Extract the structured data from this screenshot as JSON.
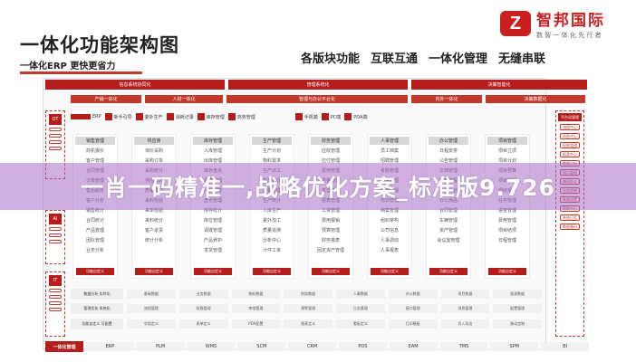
{
  "header": {
    "title": "一体化功能架构图",
    "subtitle": "一体化ERP 更快更省力",
    "features": [
      "各版块功能",
      "互联互通",
      "一体化管理",
      "无缝串联"
    ]
  },
  "logo": {
    "mark": "Z",
    "name": "智邦国际",
    "slogan": "数 智 一 体 化 先 行 者"
  },
  "top_bars": [
    "信息系统协同化",
    "管理系统化",
    "决策智能化"
  ],
  "sub_bars": [
    "产销一体化",
    "人财一体化",
    "管理与办公平台化",
    "内外一体化",
    "决策数据化"
  ],
  "left_tags": [
    "OT",
    "AI",
    "IT"
  ],
  "tools": [
    "ERP",
    "新手引导",
    "委外生产",
    "消耗记录",
    "库存管理",
    "商务管理",
    "手机端",
    "PC端",
    "PDA端"
  ],
  "modules": [
    {
      "head": "销售管理",
      "items": [
        "商机报价",
        "客户管理",
        "合同管理",
        "订单管理",
        "售后服务",
        "客户分析",
        "销售统计",
        "合同统计",
        "产品管理",
        "团队管理",
        "业务分析"
      ]
    },
    {
      "head": "供应商",
      "items": [
        "询价采购",
        "采购订单",
        "采购统计",
        "供应管理",
        "质量检验",
        "来料检验",
        "来单检验",
        "来料统计",
        "客户退货",
        "统计分析"
      ]
    },
    {
      "head": "库存管理",
      "items": [
        "入库管理",
        "出库管理",
        "库存盘点",
        "调拨管理",
        "库存预警",
        "盘点管理",
        "库存统计",
        "库位管理",
        "调拨管理",
        "产品养护",
        "发货管理"
      ]
    },
    {
      "head": "生产管理",
      "items": [
        "生产计划",
        "物料需求",
        "生产派工",
        "生产执行",
        "质量管理",
        "生产统计",
        "入库生产",
        "委外加工",
        "质量追溯",
        "分析中心",
        "计件工资"
      ]
    },
    {
      "head": "财务管理",
      "items": [
        "应收管理",
        "应付管理",
        "费用管理",
        "资金管理",
        "凭证管理",
        "报表管理",
        "工资管理",
        "费用报销",
        "预算管理",
        "财务报表",
        "固定资产管理"
      ]
    },
    {
      "head": "人事管理",
      "items": [
        "员工档案",
        "招聘管理",
        "考勤管理",
        "薪资管理",
        "绩效管理",
        "培训管理",
        "档案管理",
        "组织架构",
        "公司信息",
        "人事调动",
        "人事报表"
      ]
    },
    {
      "head": "办公管理",
      "items": [
        "日程安排",
        "公告管理",
        "文档管理",
        "审批流程",
        "工作计划",
        "办公用品",
        "合同管理",
        "车辆管理",
        "资产管理",
        "会议室管理"
      ]
    },
    {
      "head": "项目管理",
      "items": [
        "项目立项",
        "项目计划",
        "项目预算",
        "项目执行",
        "项目报表",
        "任务管理",
        "进度管理",
        "费用管理",
        "项目结项",
        "日程管理"
      ]
    }
  ],
  "module_foot": "功能自定义",
  "right_panel": {
    "head": "平台化管理",
    "items": [
      "流程中心",
      "消息中心",
      "权限管理",
      "报表中心",
      "数据分析",
      "接口管理",
      "移动办公",
      "业务定制",
      "系统设置",
      "帮助中心",
      "系统日志",
      "数据备份"
    ]
  },
  "lower_rows": [
    {
      "label": "数据分析 实时化",
      "cells": [
        "基础数据",
        "业务数据",
        "物料数据",
        "财务数据",
        "人事数据",
        "办公数据",
        "项目数据",
        "报表数据"
      ]
    },
    {
      "label": "管理优化 系统化",
      "cells": [
        "流程管理",
        "权限管理",
        "审批管理",
        "预警管理",
        "日志管理",
        "接口管理",
        "消息管理",
        "配置管理"
      ]
    },
    {
      "label": "功能自定义 可配置",
      "cells": [
        "字段定义",
        "表单定义",
        "PDA配置",
        "报表定义",
        "看板定义",
        "打印模板",
        "导入导出",
        "移动定制"
      ]
    }
  ],
  "bottom": {
    "main": "一体化管理",
    "items": [
      "ERP",
      "PLM",
      "WMS",
      "SCM",
      "CRM",
      "POS",
      "EAM",
      "TMS",
      "SPM",
      "BI"
    ]
  },
  "watermark": "一肖一码精准一,战略优化方案_标准版9.726"
}
